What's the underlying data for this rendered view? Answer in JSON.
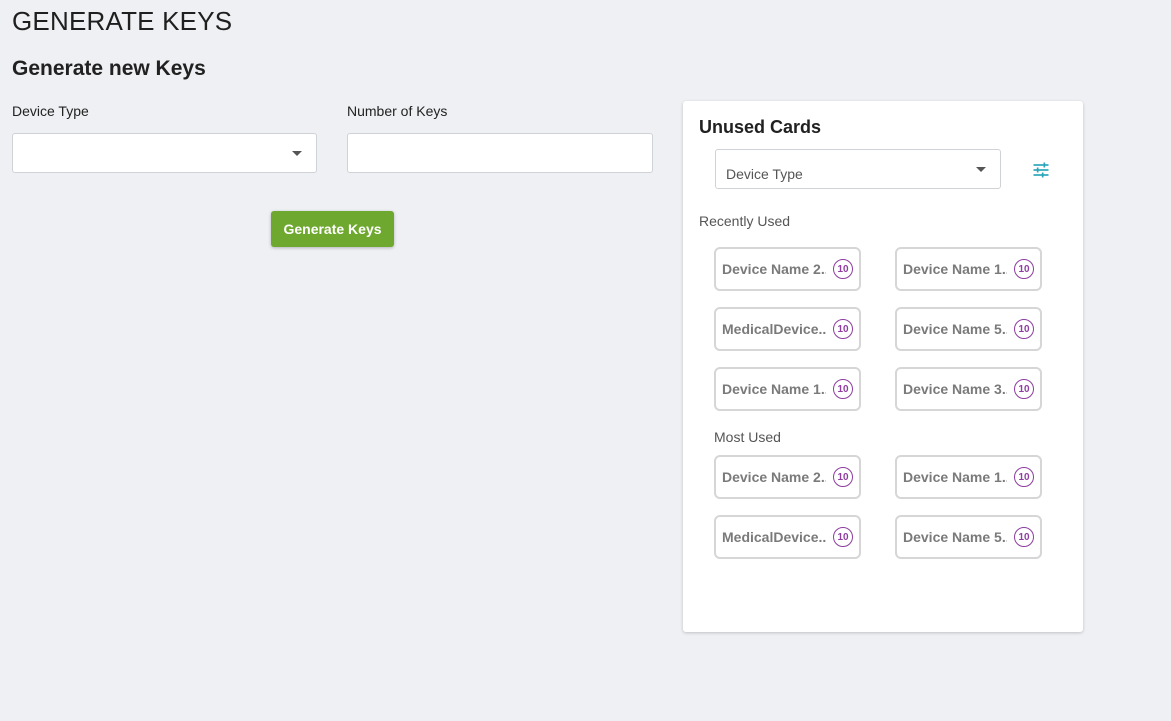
{
  "page": {
    "title": "GENERATE KEYS"
  },
  "form": {
    "section_title": "Generate new Keys",
    "device_type_label": "Device Type",
    "device_type_value": "",
    "count_label": "Number of Keys",
    "count_value": "",
    "generate_button": "Generate Keys",
    "button_color": "#6ea82e"
  },
  "unused_cards": {
    "title": "Unused Cards",
    "device_type_placeholder": "Device Type",
    "filter_icon": "tune-sliders-icon",
    "accent_color": "#2aa5b8",
    "badge_color": "#8e3ea0",
    "recently_used_label": "Recently Used",
    "recently_used": [
      {
        "name": "Device Name 2..",
        "count": "10"
      },
      {
        "name": "Device Name 1..",
        "count": "10"
      },
      {
        "name": "MedicalDevice..",
        "count": "10"
      },
      {
        "name": "Device Name 5..",
        "count": "10"
      },
      {
        "name": "Device Name 1..",
        "count": "10"
      },
      {
        "name": "Device Name 3..",
        "count": "10"
      }
    ],
    "most_used_label": "Most Used",
    "most_used": [
      {
        "name": "Device Name 2..",
        "count": "10"
      },
      {
        "name": "Device Name 1..",
        "count": "10"
      },
      {
        "name": "MedicalDevice..",
        "count": "10"
      },
      {
        "name": "Device Name 5..",
        "count": "10"
      }
    ]
  }
}
